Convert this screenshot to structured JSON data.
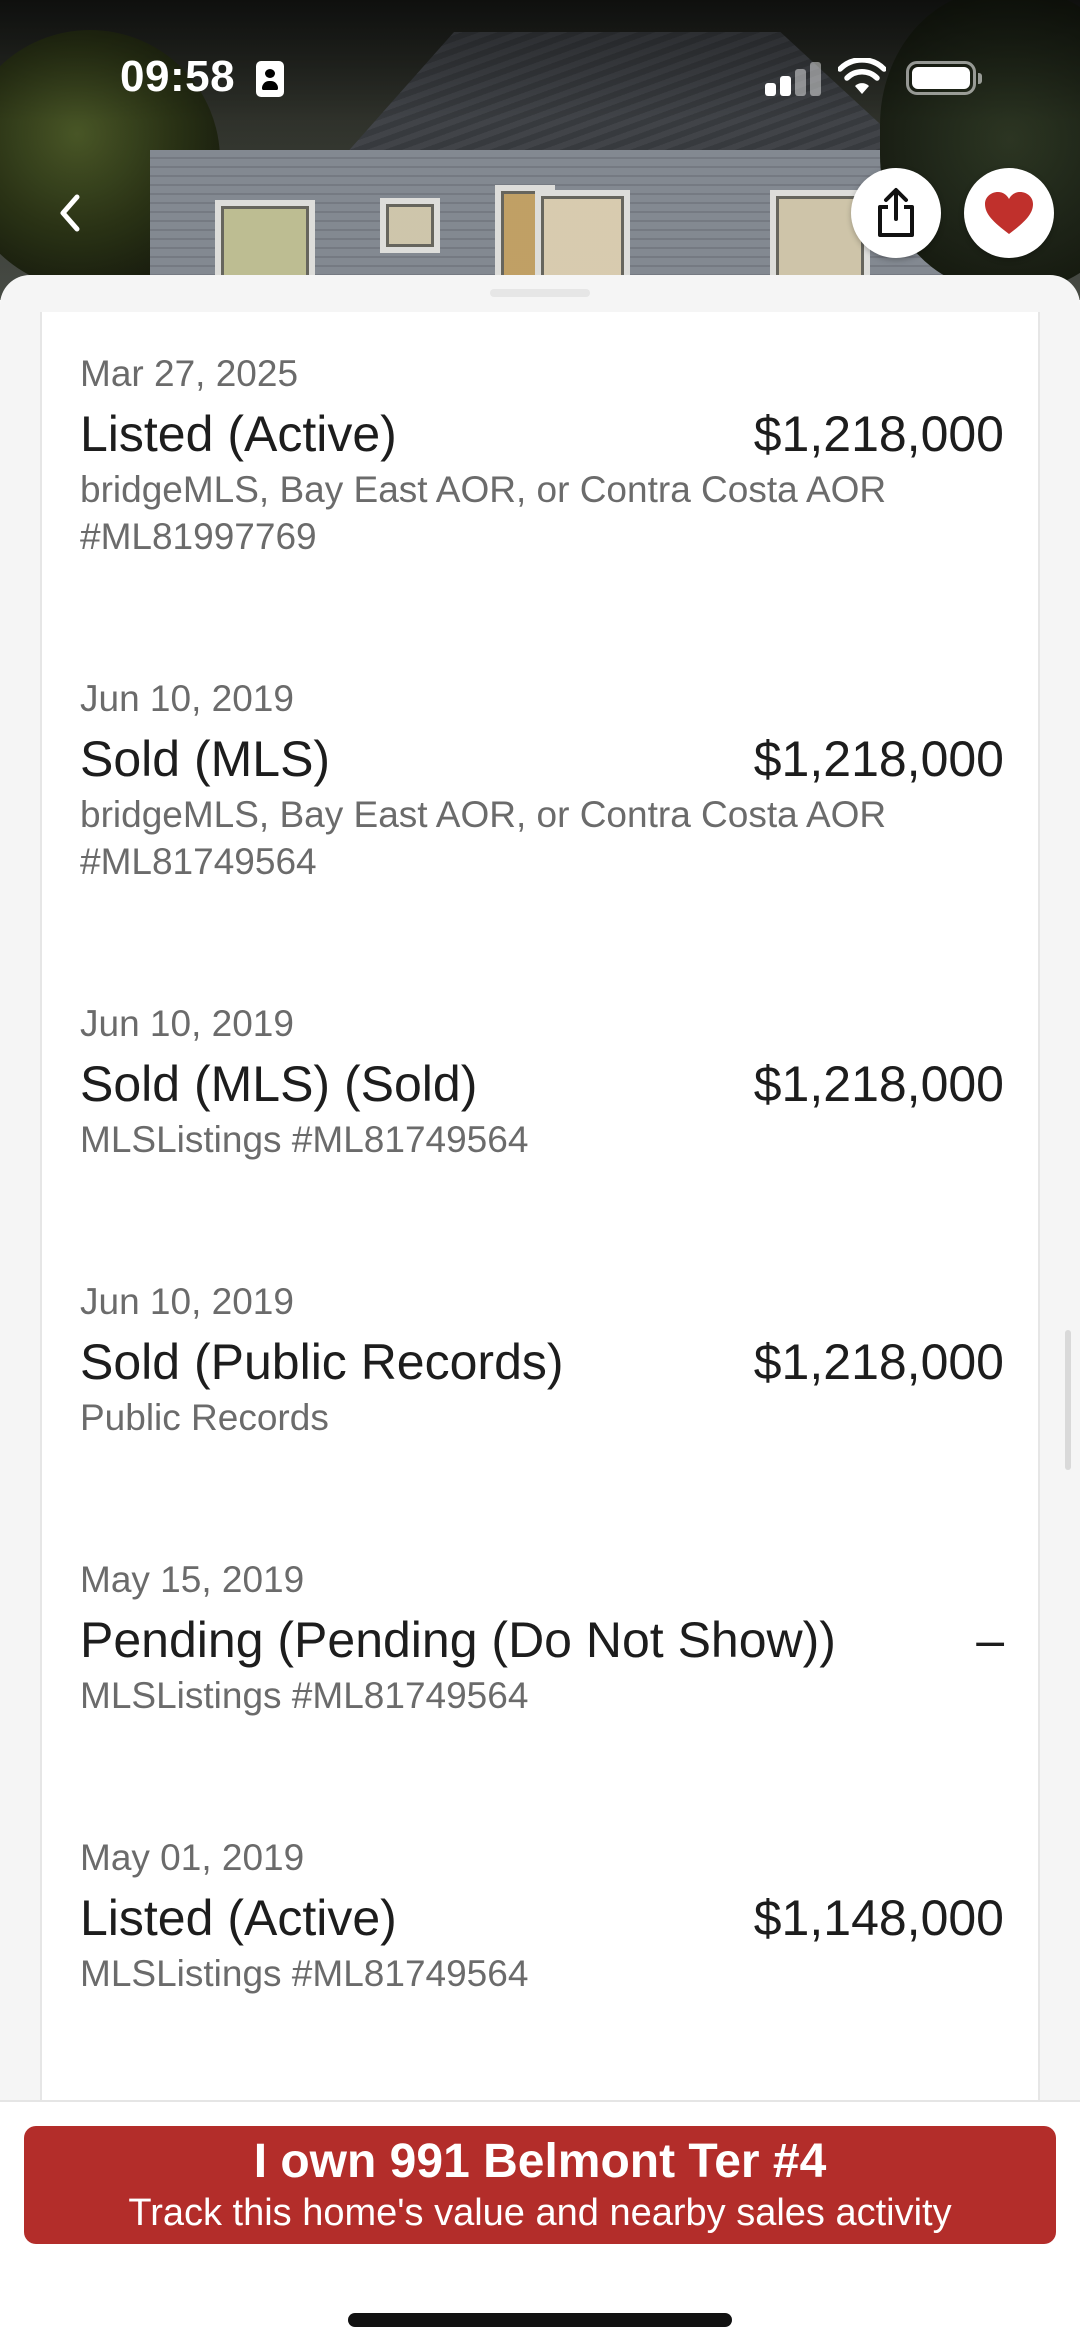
{
  "status_bar": {
    "time": "09:58"
  },
  "header": {
    "back_icon": "chevron-left-icon",
    "share_icon": "share-icon",
    "favorite_icon": "heart-icon",
    "favorite_color": "#c0302c"
  },
  "history": [
    {
      "date": "Mar 27, 2025",
      "event": "Listed (Active)",
      "price": "$1,218,000",
      "source": "bridgeMLS, Bay East AOR, or Contra Costa AOR #ML81997769"
    },
    {
      "date": "Jun 10, 2019",
      "event": "Sold (MLS)",
      "price": "$1,218,000",
      "source": "bridgeMLS, Bay East AOR, or Contra Costa AOR #ML81749564"
    },
    {
      "date": "Jun 10, 2019",
      "event": "Sold (MLS) (Sold)",
      "price": "$1,218,000",
      "source": "MLSListings #ML81749564"
    },
    {
      "date": "Jun 10, 2019",
      "event": "Sold (Public Records)",
      "price": "$1,218,000",
      "source": "Public Records"
    },
    {
      "date": "May 15, 2019",
      "event": "Pending (Pending (Do Not Show))",
      "price": "–",
      "source": "MLSListings #ML81749564"
    },
    {
      "date": "May 01, 2019",
      "event": "Listed (Active)",
      "price": "$1,148,000",
      "source": "MLSListings #ML81749564"
    }
  ],
  "cta": {
    "title": "I own 991 Belmont Ter #4",
    "subtitle": "Track this home's value and nearby sales activity",
    "color": "#b32d2a"
  }
}
